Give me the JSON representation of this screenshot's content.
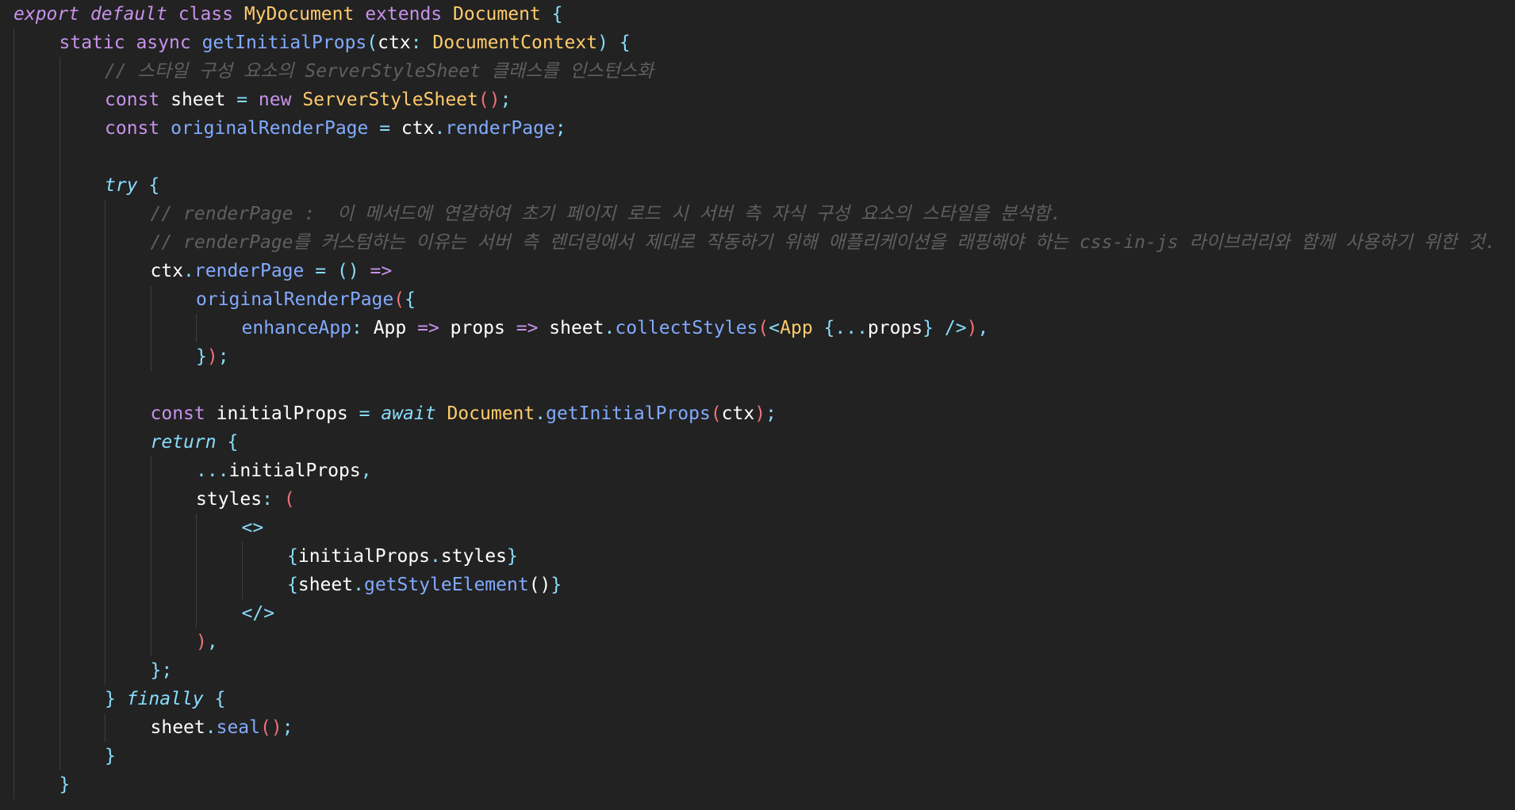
{
  "editor": {
    "colors": {
      "background": "#222222",
      "keyword": "#c792ea",
      "flow_keyword": "#89ddff",
      "class_name": "#ffcb6b",
      "function": "#82aaff",
      "plain": "#ffffff",
      "punctuation": "#89ddff",
      "paren": "#f07178",
      "comment": "#5f5f5f"
    },
    "lines": [
      {
        "indent": 0,
        "tokens": [
          {
            "t": "export",
            "k": "kwi"
          },
          {
            "t": " ",
            "k": "var"
          },
          {
            "t": "default",
            "k": "kwi"
          },
          {
            "t": " ",
            "k": "var"
          },
          {
            "t": "class",
            "k": "kw"
          },
          {
            "t": " ",
            "k": "var"
          },
          {
            "t": "MyDocument",
            "k": "cls"
          },
          {
            "t": " ",
            "k": "var"
          },
          {
            "t": "extends",
            "k": "kw"
          },
          {
            "t": " ",
            "k": "var"
          },
          {
            "t": "Document",
            "k": "cls"
          },
          {
            "t": " ",
            "k": "var"
          },
          {
            "t": "{",
            "k": "punc"
          }
        ]
      },
      {
        "indent": 1,
        "tokens": [
          {
            "t": "static",
            "k": "kw"
          },
          {
            "t": " ",
            "k": "var"
          },
          {
            "t": "async",
            "k": "kw"
          },
          {
            "t": " ",
            "k": "var"
          },
          {
            "t": "getInitialProps",
            "k": "fn"
          },
          {
            "t": "(",
            "k": "punc"
          },
          {
            "t": "ctx",
            "k": "var"
          },
          {
            "t": ": ",
            "k": "punc"
          },
          {
            "t": "DocumentContext",
            "k": "cls"
          },
          {
            "t": ")",
            "k": "punc"
          },
          {
            "t": " ",
            "k": "var"
          },
          {
            "t": "{",
            "k": "punc"
          }
        ]
      },
      {
        "indent": 2,
        "tokens": [
          {
            "t": "// 스타일 구성 요소의 ServerStyleSheet 클래스를 인스턴스화",
            "k": "cmt"
          }
        ]
      },
      {
        "indent": 2,
        "tokens": [
          {
            "t": "const",
            "k": "kw"
          },
          {
            "t": " sheet ",
            "k": "var"
          },
          {
            "t": "=",
            "k": "op"
          },
          {
            "t": " ",
            "k": "var"
          },
          {
            "t": "new",
            "k": "kw"
          },
          {
            "t": " ",
            "k": "var"
          },
          {
            "t": "ServerStyleSheet",
            "k": "cls"
          },
          {
            "t": "()",
            "k": "paren"
          },
          {
            "t": ";",
            "k": "punc"
          }
        ]
      },
      {
        "indent": 2,
        "tokens": [
          {
            "t": "const",
            "k": "kw"
          },
          {
            "t": " ",
            "k": "var"
          },
          {
            "t": "originalRenderPage",
            "k": "fn"
          },
          {
            "t": " ",
            "k": "var"
          },
          {
            "t": "=",
            "k": "op"
          },
          {
            "t": " ctx",
            "k": "var"
          },
          {
            "t": ".",
            "k": "punc"
          },
          {
            "t": "renderPage",
            "k": "prop"
          },
          {
            "t": ";",
            "k": "punc"
          }
        ]
      },
      {
        "indent": 0,
        "tokens": []
      },
      {
        "indent": 2,
        "tokens": [
          {
            "t": "try",
            "k": "flow"
          },
          {
            "t": " ",
            "k": "var"
          },
          {
            "t": "{",
            "k": "punc"
          }
        ]
      },
      {
        "indent": 3,
        "tokens": [
          {
            "t": "// renderPage :  이 메서드에 연갈하여 초기 페이지 로드 시 서버 측 자식 구성 요소의 스타일을 분석함.",
            "k": "cmt"
          }
        ]
      },
      {
        "indent": 3,
        "tokens": [
          {
            "t": "// renderPage를 커스텀하는 이유는 서버 측 렌더링에서 제대로 작동하기 위해 애플리케이션을 래핑해야 하는 css-in-js 라이브러리와 함께 사용하기 위한 것.",
            "k": "cmt"
          }
        ]
      },
      {
        "indent": 3,
        "tokens": [
          {
            "t": "ctx",
            "k": "var"
          },
          {
            "t": ".",
            "k": "punc"
          },
          {
            "t": "renderPage",
            "k": "prop"
          },
          {
            "t": " ",
            "k": "var"
          },
          {
            "t": "=",
            "k": "op"
          },
          {
            "t": " ",
            "k": "var"
          },
          {
            "t": "()",
            "k": "punc"
          },
          {
            "t": " ",
            "k": "var"
          },
          {
            "t": "=>",
            "k": "kw"
          }
        ]
      },
      {
        "indent": 4,
        "tokens": [
          {
            "t": "originalRenderPage",
            "k": "fn"
          },
          {
            "t": "(",
            "k": "paren"
          },
          {
            "t": "{",
            "k": "punc"
          }
        ]
      },
      {
        "indent": 5,
        "tokens": [
          {
            "t": "enhanceApp",
            "k": "prop"
          },
          {
            "t": ":",
            "k": "punc"
          },
          {
            "t": " App ",
            "k": "var"
          },
          {
            "t": "=>",
            "k": "kw"
          },
          {
            "t": " props ",
            "k": "var"
          },
          {
            "t": "=>",
            "k": "kw"
          },
          {
            "t": " sheet",
            "k": "var"
          },
          {
            "t": ".",
            "k": "punc"
          },
          {
            "t": "collectStyles",
            "k": "fn"
          },
          {
            "t": "(",
            "k": "paren"
          },
          {
            "t": "<",
            "k": "punc"
          },
          {
            "t": "App",
            "k": "cls"
          },
          {
            "t": " ",
            "k": "var"
          },
          {
            "t": "{...",
            "k": "punc"
          },
          {
            "t": "props",
            "k": "var"
          },
          {
            "t": "}",
            "k": "punc"
          },
          {
            "t": " ",
            "k": "var"
          },
          {
            "t": "/>",
            "k": "punc"
          },
          {
            "t": ")",
            "k": "paren"
          },
          {
            "t": ",",
            "k": "punc"
          }
        ]
      },
      {
        "indent": 4,
        "tokens": [
          {
            "t": "}",
            "k": "punc"
          },
          {
            "t": ")",
            "k": "paren"
          },
          {
            "t": ";",
            "k": "punc"
          }
        ]
      },
      {
        "indent": 0,
        "tokens": []
      },
      {
        "indent": 3,
        "tokens": [
          {
            "t": "const",
            "k": "kw"
          },
          {
            "t": " initialProps ",
            "k": "var"
          },
          {
            "t": "=",
            "k": "op"
          },
          {
            "t": " ",
            "k": "var"
          },
          {
            "t": "await",
            "k": "flow"
          },
          {
            "t": " ",
            "k": "var"
          },
          {
            "t": "Document",
            "k": "cls"
          },
          {
            "t": ".",
            "k": "punc"
          },
          {
            "t": "getInitialProps",
            "k": "fn"
          },
          {
            "t": "(",
            "k": "paren"
          },
          {
            "t": "ctx",
            "k": "var"
          },
          {
            "t": ")",
            "k": "paren"
          },
          {
            "t": ";",
            "k": "punc"
          }
        ]
      },
      {
        "indent": 3,
        "tokens": [
          {
            "t": "return",
            "k": "flow"
          },
          {
            "t": " ",
            "k": "var"
          },
          {
            "t": "{",
            "k": "punc"
          }
        ]
      },
      {
        "indent": 4,
        "tokens": [
          {
            "t": "...",
            "k": "punc"
          },
          {
            "t": "initialProps",
            "k": "var"
          },
          {
            "t": ",",
            "k": "punc"
          }
        ]
      },
      {
        "indent": 4,
        "tokens": [
          {
            "t": "styles",
            "k": "var"
          },
          {
            "t": ":",
            "k": "punc"
          },
          {
            "t": " ",
            "k": "var"
          },
          {
            "t": "(",
            "k": "paren"
          }
        ]
      },
      {
        "indent": 5,
        "tokens": [
          {
            "t": "<>",
            "k": "punc"
          }
        ]
      },
      {
        "indent": 6,
        "tokens": [
          {
            "t": "{",
            "k": "punc"
          },
          {
            "t": "initialProps",
            "k": "var"
          },
          {
            "t": ".",
            "k": "punc"
          },
          {
            "t": "styles",
            "k": "var"
          },
          {
            "t": "}",
            "k": "punc"
          }
        ]
      },
      {
        "indent": 6,
        "tokens": [
          {
            "t": "{",
            "k": "punc"
          },
          {
            "t": "sheet",
            "k": "var"
          },
          {
            "t": ".",
            "k": "punc"
          },
          {
            "t": "getStyleElement",
            "k": "fn"
          },
          {
            "t": "()",
            "k": "var"
          },
          {
            "t": "}",
            "k": "punc"
          }
        ]
      },
      {
        "indent": 5,
        "tokens": [
          {
            "t": "</>",
            "k": "punc"
          }
        ]
      },
      {
        "indent": 4,
        "tokens": [
          {
            "t": ")",
            "k": "paren"
          },
          {
            "t": ",",
            "k": "punc"
          }
        ]
      },
      {
        "indent": 3,
        "tokens": [
          {
            "t": "}",
            "k": "punc"
          },
          {
            "t": ";",
            "k": "punc"
          }
        ]
      },
      {
        "indent": 2,
        "tokens": [
          {
            "t": "}",
            "k": "punc"
          },
          {
            "t": " ",
            "k": "var"
          },
          {
            "t": "finally",
            "k": "flow"
          },
          {
            "t": " ",
            "k": "var"
          },
          {
            "t": "{",
            "k": "punc"
          }
        ]
      },
      {
        "indent": 3,
        "tokens": [
          {
            "t": "sheet",
            "k": "var"
          },
          {
            "t": ".",
            "k": "punc"
          },
          {
            "t": "seal",
            "k": "fn"
          },
          {
            "t": "()",
            "k": "paren"
          },
          {
            "t": ";",
            "k": "punc"
          }
        ]
      },
      {
        "indent": 2,
        "tokens": [
          {
            "t": "}",
            "k": "punc"
          }
        ]
      },
      {
        "indent": 1,
        "tokens": [
          {
            "t": "}",
            "k": "punc"
          }
        ]
      }
    ]
  }
}
